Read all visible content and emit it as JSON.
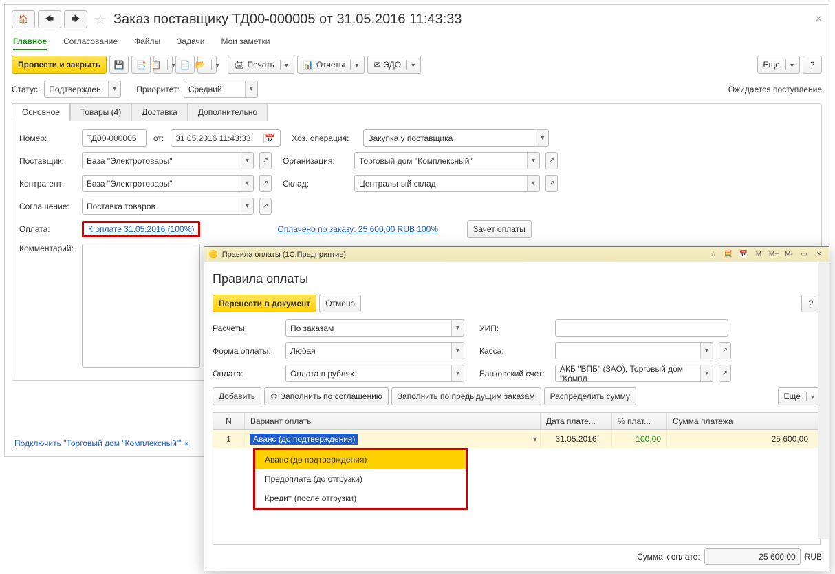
{
  "title": "Заказ поставщику ТД00-000005 от 31.05.2016 11:43:33",
  "mainTabs": [
    "Главное",
    "Согласование",
    "Файлы",
    "Задачи",
    "Мои заметки"
  ],
  "toolbar": {
    "postClose": "Провести и закрыть",
    "print": "Печать",
    "reports": "Отчеты",
    "edo": "ЭДО",
    "more": "Еще"
  },
  "statusBar": {
    "statusLabel": "Статус:",
    "statusValue": "Подтвержден",
    "priorityLabel": "Приоритет:",
    "priorityValue": "Средний",
    "expected": "Ожидается поступление"
  },
  "subTabs": [
    "Основное",
    "Товары (4)",
    "Доставка",
    "Дополнительно"
  ],
  "fields": {
    "numberLabel": "Номер:",
    "numberValue": "ТД00-000005",
    "fromLabel": "от:",
    "dateValue": "31.05.2016 11:43:33",
    "hozOpLabel": "Хоз. операция:",
    "hozOpValue": "Закупка у поставщика",
    "supplierLabel": "Поставщик:",
    "supplierValue": "База \"Электротовары\"",
    "orgLabel": "Организация:",
    "orgValue": "Торговый дом \"Комплексный\"",
    "contragentLabel": "Контрагент:",
    "contragentValue": "База \"Электротовары\"",
    "warehouseLabel": "Склад:",
    "warehouseValue": "Центральный склад",
    "agreementLabel": "Соглашение:",
    "agreementValue": "Поставка товаров",
    "paymentLabel": "Оплата:",
    "paymentLink": "К оплате 31.05.2016 (100%)",
    "paidLink": "Оплачено по заказу: 25 600,00 RUB  100%",
    "offsetBtn": "Зачет оплаты",
    "commentLabel": "Комментарий:"
  },
  "bottomLink": "Подключить \"Торговый дом \"Комплексный\"\" к",
  "modal": {
    "winTitle": "Правила оплаты  (1С:Предприятие)",
    "titleIcons": {
      "m": "M",
      "mPlus": "M+",
      "mMinus": "M-"
    },
    "title": "Правила оплаты",
    "transfer": "Перенести в документ",
    "cancel": "Отмена",
    "help": "?",
    "more": "Еще",
    "calcLabel": "Расчеты:",
    "calcValue": "По заказам",
    "uipLabel": "УИП:",
    "formLabel": "Форма оплаты:",
    "formValue": "Любая",
    "kassaLabel": "Касса:",
    "payLabel": "Оплата:",
    "payValue": "Оплата в рублях",
    "bankLabel": "Банковский счет:",
    "bankValue": "АКБ \"ВПБ\" (ЗАО), Торговый дом \"Компл",
    "addBtn": "Добавить",
    "fillBtn": "Заполнить по соглашению",
    "fillPrevBtn": "Заполнить по предыдущим заказам",
    "distributeBtn": "Распределить сумму",
    "cols": {
      "n": "N",
      "variant": "Вариант оплаты",
      "date": "Дата плате...",
      "pct": "% плат...",
      "sum": "Сумма платежа"
    },
    "row": {
      "n": "1",
      "variant": "Аванс (до подтверждения)",
      "date": "31.05.2016",
      "pct": "100,00",
      "sum": "25 600,00"
    },
    "dropdown": [
      "Аванс (до подтверждения)",
      "Предоплата (до отгрузки)",
      "Кредит (после отгрузки)"
    ],
    "footerLabel": "Сумма к оплате:",
    "footerSum": "25 600,00",
    "footerCur": "RUB"
  }
}
